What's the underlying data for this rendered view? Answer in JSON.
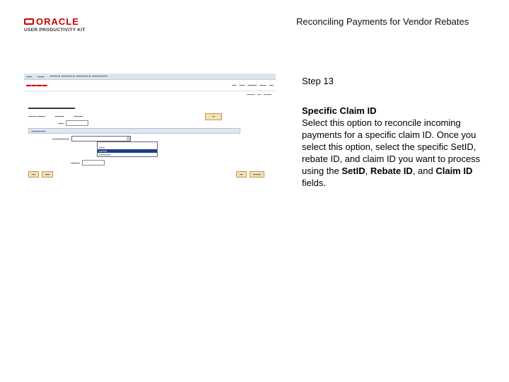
{
  "logo": {
    "brand": "ORACLE",
    "product": "USER PRODUCTIVITY KIT"
  },
  "doc_title": "Reconciling Payments for Vendor Rebates",
  "step_label": "Step 13",
  "step_heading": "Specific Claim ID",
  "desc": {
    "part1": "Select this option to reconcile incoming payments for a specific claim ID. Once you select this option, select the specific SetID, rebate ID, and claim ID you want to process using the ",
    "f1": "SetID",
    "sep1": ", ",
    "f2": "Rebate ID",
    "sep2": ", and ",
    "f3": "Claim ID",
    "end": " fields."
  }
}
